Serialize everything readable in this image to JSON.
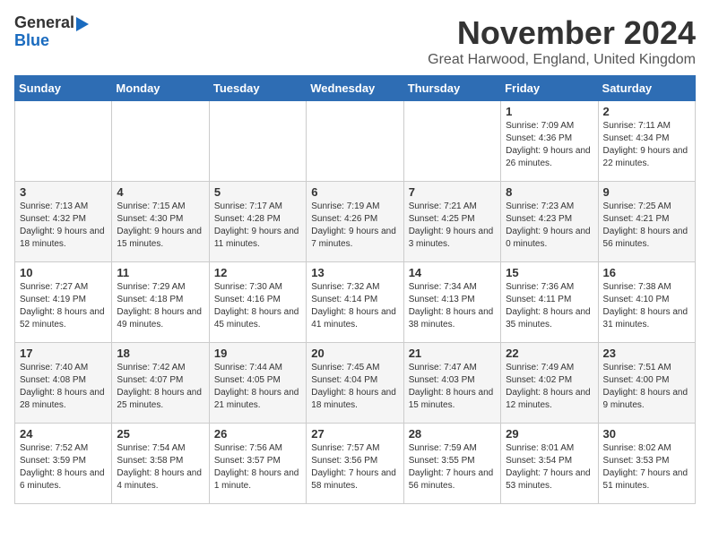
{
  "logo": {
    "line1": "General",
    "line2": "Blue"
  },
  "title": "November 2024",
  "location": "Great Harwood, England, United Kingdom",
  "weekdays": [
    "Sunday",
    "Monday",
    "Tuesday",
    "Wednesday",
    "Thursday",
    "Friday",
    "Saturday"
  ],
  "weeks": [
    [
      {
        "day": "",
        "info": ""
      },
      {
        "day": "",
        "info": ""
      },
      {
        "day": "",
        "info": ""
      },
      {
        "day": "",
        "info": ""
      },
      {
        "day": "",
        "info": ""
      },
      {
        "day": "1",
        "info": "Sunrise: 7:09 AM\nSunset: 4:36 PM\nDaylight: 9 hours and 26 minutes."
      },
      {
        "day": "2",
        "info": "Sunrise: 7:11 AM\nSunset: 4:34 PM\nDaylight: 9 hours and 22 minutes."
      }
    ],
    [
      {
        "day": "3",
        "info": "Sunrise: 7:13 AM\nSunset: 4:32 PM\nDaylight: 9 hours and 18 minutes."
      },
      {
        "day": "4",
        "info": "Sunrise: 7:15 AM\nSunset: 4:30 PM\nDaylight: 9 hours and 15 minutes."
      },
      {
        "day": "5",
        "info": "Sunrise: 7:17 AM\nSunset: 4:28 PM\nDaylight: 9 hours and 11 minutes."
      },
      {
        "day": "6",
        "info": "Sunrise: 7:19 AM\nSunset: 4:26 PM\nDaylight: 9 hours and 7 minutes."
      },
      {
        "day": "7",
        "info": "Sunrise: 7:21 AM\nSunset: 4:25 PM\nDaylight: 9 hours and 3 minutes."
      },
      {
        "day": "8",
        "info": "Sunrise: 7:23 AM\nSunset: 4:23 PM\nDaylight: 9 hours and 0 minutes."
      },
      {
        "day": "9",
        "info": "Sunrise: 7:25 AM\nSunset: 4:21 PM\nDaylight: 8 hours and 56 minutes."
      }
    ],
    [
      {
        "day": "10",
        "info": "Sunrise: 7:27 AM\nSunset: 4:19 PM\nDaylight: 8 hours and 52 minutes."
      },
      {
        "day": "11",
        "info": "Sunrise: 7:29 AM\nSunset: 4:18 PM\nDaylight: 8 hours and 49 minutes."
      },
      {
        "day": "12",
        "info": "Sunrise: 7:30 AM\nSunset: 4:16 PM\nDaylight: 8 hours and 45 minutes."
      },
      {
        "day": "13",
        "info": "Sunrise: 7:32 AM\nSunset: 4:14 PM\nDaylight: 8 hours and 41 minutes."
      },
      {
        "day": "14",
        "info": "Sunrise: 7:34 AM\nSunset: 4:13 PM\nDaylight: 8 hours and 38 minutes."
      },
      {
        "day": "15",
        "info": "Sunrise: 7:36 AM\nSunset: 4:11 PM\nDaylight: 8 hours and 35 minutes."
      },
      {
        "day": "16",
        "info": "Sunrise: 7:38 AM\nSunset: 4:10 PM\nDaylight: 8 hours and 31 minutes."
      }
    ],
    [
      {
        "day": "17",
        "info": "Sunrise: 7:40 AM\nSunset: 4:08 PM\nDaylight: 8 hours and 28 minutes."
      },
      {
        "day": "18",
        "info": "Sunrise: 7:42 AM\nSunset: 4:07 PM\nDaylight: 8 hours and 25 minutes."
      },
      {
        "day": "19",
        "info": "Sunrise: 7:44 AM\nSunset: 4:05 PM\nDaylight: 8 hours and 21 minutes."
      },
      {
        "day": "20",
        "info": "Sunrise: 7:45 AM\nSunset: 4:04 PM\nDaylight: 8 hours and 18 minutes."
      },
      {
        "day": "21",
        "info": "Sunrise: 7:47 AM\nSunset: 4:03 PM\nDaylight: 8 hours and 15 minutes."
      },
      {
        "day": "22",
        "info": "Sunrise: 7:49 AM\nSunset: 4:02 PM\nDaylight: 8 hours and 12 minutes."
      },
      {
        "day": "23",
        "info": "Sunrise: 7:51 AM\nSunset: 4:00 PM\nDaylight: 8 hours and 9 minutes."
      }
    ],
    [
      {
        "day": "24",
        "info": "Sunrise: 7:52 AM\nSunset: 3:59 PM\nDaylight: 8 hours and 6 minutes."
      },
      {
        "day": "25",
        "info": "Sunrise: 7:54 AM\nSunset: 3:58 PM\nDaylight: 8 hours and 4 minutes."
      },
      {
        "day": "26",
        "info": "Sunrise: 7:56 AM\nSunset: 3:57 PM\nDaylight: 8 hours and 1 minute."
      },
      {
        "day": "27",
        "info": "Sunrise: 7:57 AM\nSunset: 3:56 PM\nDaylight: 7 hours and 58 minutes."
      },
      {
        "day": "28",
        "info": "Sunrise: 7:59 AM\nSunset: 3:55 PM\nDaylight: 7 hours and 56 minutes."
      },
      {
        "day": "29",
        "info": "Sunrise: 8:01 AM\nSunset: 3:54 PM\nDaylight: 7 hours and 53 minutes."
      },
      {
        "day": "30",
        "info": "Sunrise: 8:02 AM\nSunset: 3:53 PM\nDaylight: 7 hours and 51 minutes."
      }
    ]
  ]
}
